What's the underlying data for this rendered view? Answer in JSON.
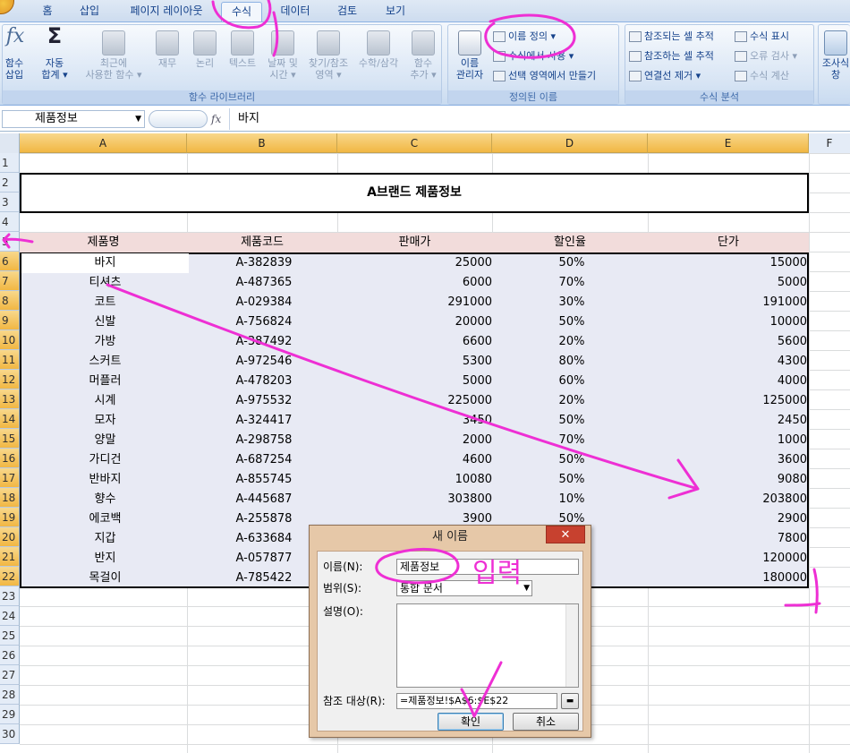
{
  "ribbon_tabs": [
    "홈",
    "삽입",
    "페이지 레이아웃",
    "수식",
    "데이터",
    "검토",
    "보기"
  ],
  "active_tab": "수식",
  "groups": {
    "function_library": {
      "caption": "함수 라이브러리",
      "insert_function": "함수 삽입",
      "autosum": [
        "자동",
        "합계 ▾"
      ],
      "recent": [
        "최근에",
        "사용한 함수 ▾"
      ],
      "finance": "재무",
      "logical": "논리",
      "text": "텍스트",
      "datetime": [
        "날짜 및",
        "시간 ▾"
      ],
      "lookup": [
        "찾기/참조",
        "영역 ▾"
      ],
      "math": "수학/삼각",
      "more": [
        "함수",
        "추가 ▾"
      ]
    },
    "defined_names": {
      "caption": "정의된 이름",
      "manager": [
        "이름",
        "관리자"
      ],
      "define_name": "이름 정의 ▾",
      "use_in_formula": "수식에서 사용 ▾",
      "create_from_selection": "선택 영역에서 만들기"
    },
    "formula_auditing": {
      "caption": "수식 분석",
      "trace_precedents": "참조되는 셀 추적",
      "trace_dependents": "참조하는 셀 추적",
      "remove_arrows": "연결선 제거 ▾",
      "show_formulas": "수식 표시",
      "error_checking": "오류 검사 ▾",
      "evaluate_formula": "수식 계산"
    },
    "watch_window": [
      "조사식",
      "창"
    ]
  },
  "name_box": "제품정보",
  "formula_value": "바지",
  "columns": [
    "A",
    "B",
    "C",
    "D",
    "E",
    "F"
  ],
  "rows": [
    "1",
    "2",
    "3",
    "4",
    "5",
    "6",
    "7",
    "8",
    "9",
    "10",
    "11",
    "12",
    "13",
    "14",
    "15",
    "16",
    "17",
    "18",
    "19",
    "20",
    "21",
    "22",
    "23",
    "24",
    "25",
    "26",
    "27",
    "28",
    "29",
    "30"
  ],
  "sheet_title": "A브랜드 제품정보",
  "table_headers": [
    "제품명",
    "제품코드",
    "판매가",
    "할인율",
    "단가"
  ],
  "table_rows": [
    [
      "바지",
      "A-382839",
      "25000",
      "50%",
      "15000"
    ],
    [
      "티셔츠",
      "A-487365",
      "6000",
      "70%",
      "5000"
    ],
    [
      "코트",
      "A-029384",
      "291000",
      "30%",
      "191000"
    ],
    [
      "신발",
      "A-756824",
      "20000",
      "50%",
      "10000"
    ],
    [
      "가방",
      "A-387492",
      "6600",
      "20%",
      "5600"
    ],
    [
      "스커트",
      "A-972546",
      "5300",
      "80%",
      "4300"
    ],
    [
      "머플러",
      "A-478203",
      "5000",
      "60%",
      "4000"
    ],
    [
      "시계",
      "A-975532",
      "225000",
      "20%",
      "125000"
    ],
    [
      "모자",
      "A-324417",
      "3450",
      "50%",
      "2450"
    ],
    [
      "양말",
      "A-298758",
      "2000",
      "70%",
      "1000"
    ],
    [
      "가디건",
      "A-687254",
      "4600",
      "50%",
      "3600"
    ],
    [
      "반바지",
      "A-855745",
      "10080",
      "50%",
      "9080"
    ],
    [
      "향수",
      "A-445687",
      "303800",
      "10%",
      "203800"
    ],
    [
      "에코백",
      "A-255878",
      "3900",
      "50%",
      "2900"
    ],
    [
      "지갑",
      "A-633684",
      "",
      "",
      "7800"
    ],
    [
      "반지",
      "A-057877",
      "",
      "",
      "120000"
    ],
    [
      "목걸이",
      "A-785422",
      "",
      "",
      "180000"
    ]
  ],
  "dialog": {
    "title": "새 이름",
    "close": "✕",
    "name_label": "이름(N):",
    "name_value": "제품정보",
    "scope_label": "범위(S):",
    "scope_value": "통합 문서",
    "comment_label": "설명(O):",
    "refers_label": "참조 대상(R):",
    "refers_value": "=제품정보!$A$6:$E$22",
    "ok": "확인",
    "cancel": "취소"
  },
  "annotation_text": "입력",
  "colors": {
    "annotation": "#ee2fd4",
    "header_fill": "#f2dcdb",
    "data_fill": "#e8eaf4",
    "col_header": "#f1b743"
  }
}
